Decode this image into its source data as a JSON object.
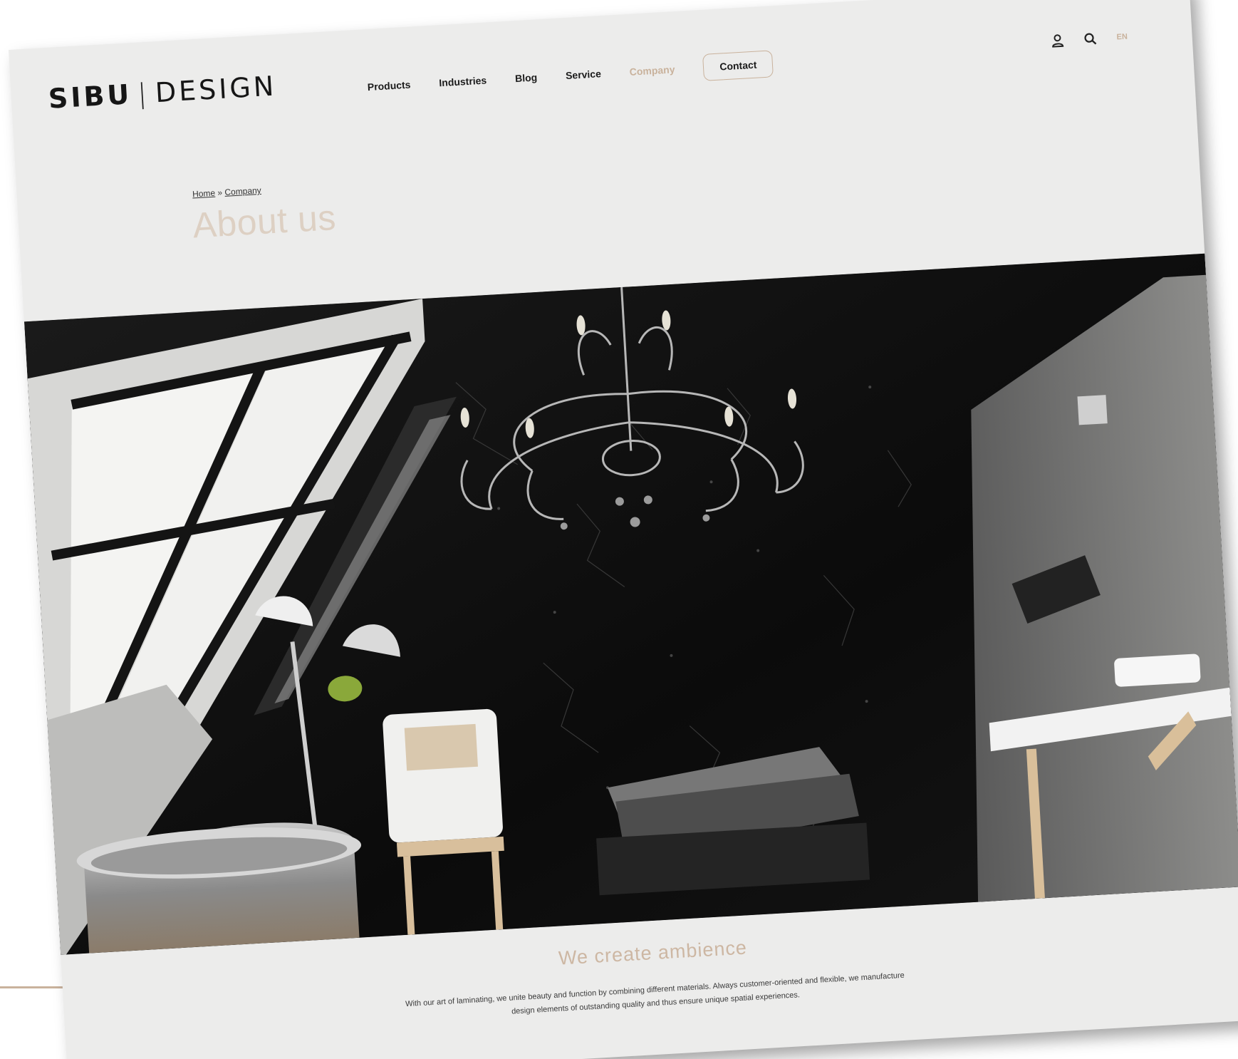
{
  "brand": {
    "name_bold": "SIBU",
    "divider": "|",
    "name_light": "DESIGN"
  },
  "nav": {
    "items": [
      "Products",
      "Industries",
      "Blog",
      "Service",
      "Company"
    ],
    "active": "Company",
    "contact_label": "Contact"
  },
  "utility": {
    "icons": [
      "user-icon",
      "search-icon"
    ],
    "language": "EN"
  },
  "breadcrumb": {
    "home": "Home",
    "separator": "»",
    "current": "Company"
  },
  "page_title": "About us",
  "hero": {
    "image_description_icon": "attic-bathroom-photo"
  },
  "section": {
    "headline": "We create ambience",
    "body_line1": "With our art of laminating, we unite beauty and function by combining different materials. Always customer-oriented and flexible, we manufacture",
    "body_line2": "design elements of outstanding quality and thus ensure unique spatial experiences."
  },
  "colors": {
    "accent": "#c9b29c",
    "page_bg": "#ececeb",
    "text_dark": "#1b1b1b"
  }
}
